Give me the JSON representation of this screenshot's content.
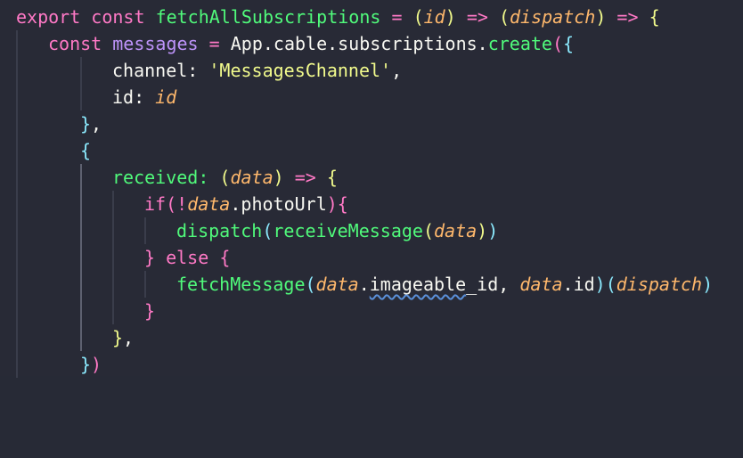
{
  "code": {
    "l1": {
      "k_export": "export",
      "k_const": "const",
      "fn_name": "fetchAllSubscriptions",
      "eq": "=",
      "p_open": "(",
      "param": "id",
      "p_close": ")",
      "arrow": "=>",
      "p2_open": "(",
      "param2": "dispatch",
      "p2_close": ")",
      "arrow2": "=>",
      "brace": "{"
    },
    "l2": {
      "k_const": "const",
      "var": "messages",
      "eq": "=",
      "obj": "App.cable.subscriptions.",
      "method": "create",
      "paren": "(",
      "brace": "{"
    },
    "l3": {
      "key": "channel:",
      "str": "'MessagesChannel'",
      "comma": ","
    },
    "l4": {
      "key": "id:",
      "param": "id"
    },
    "l5": {
      "brace": "}",
      "comma": ","
    },
    "l6": {
      "brace": "{"
    },
    "l7": {
      "key": "received:",
      "p_open": "(",
      "param": "data",
      "p_close": ")",
      "arrow": "=>",
      "brace": "{"
    },
    "l8": {
      "k_if": "if",
      "paren": "(",
      "bang": "!",
      "param": "data",
      "rest": ".photoUrl",
      "paren_close": ")",
      "brace": "{"
    },
    "l9": {
      "fn": "dispatch",
      "p_open": "(",
      "fn2": "receiveMessage",
      "p2_open": "(",
      "param": "data",
      "p2_close": ")",
      "p_close": ")"
    },
    "l10": {
      "brace_close": "}",
      "k_else": "else",
      "brace": "{"
    },
    "l11": {
      "fn": "fetchMessage",
      "p_open": "(",
      "param": "data",
      "dot": ".",
      "squig": "imageable",
      "rest": "_id,",
      "param2": "data",
      "rest2": ".id",
      "p_close": ")",
      "p2_open": "(",
      "param3": "dispatch",
      "p2_close": ")"
    },
    "l12": {
      "brace": "}"
    },
    "l13": {
      "brace": "}",
      "comma": ","
    },
    "l14": {
      "brace": "}",
      "paren": ")"
    }
  }
}
